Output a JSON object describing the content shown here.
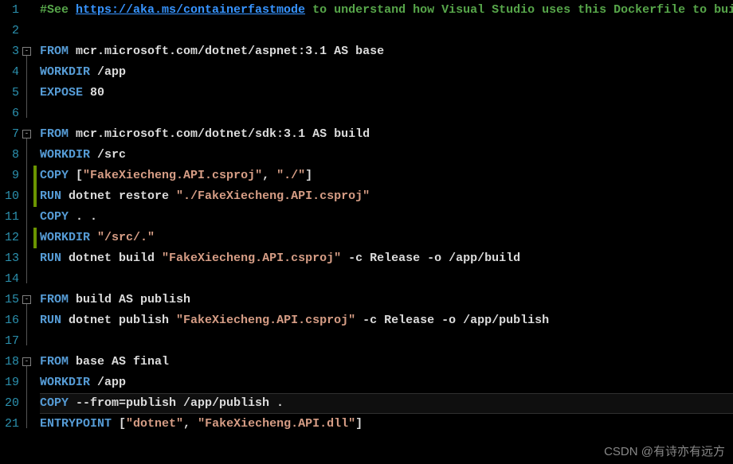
{
  "watermark": "CSDN @有诗亦有远方",
  "currentLine": 20,
  "modified": [
    9,
    10,
    12
  ],
  "foldMarks": [
    3,
    7,
    15,
    18
  ],
  "foldLines": [
    {
      "from": 3,
      "to": 6
    },
    {
      "from": 7,
      "to": 14
    },
    {
      "from": 15,
      "to": 17
    },
    {
      "from": 18,
      "to": 21
    }
  ],
  "lines": [
    {
      "n": 1,
      "tokens": [
        {
          "cls": "c-comment",
          "t": "#See "
        },
        {
          "cls": "c-link",
          "t": "https://aka.ms/containerfastmode"
        },
        {
          "cls": "c-comment",
          "t": " to understand how Visual Studio uses this Dockerfile to build "
        }
      ]
    },
    {
      "n": 2,
      "tokens": []
    },
    {
      "n": 3,
      "tokens": [
        {
          "cls": "c-kw",
          "t": "FROM"
        },
        {
          "cls": "c-white",
          "t": " mcr.microsoft.com/dotnet/aspnet:3.1 AS base"
        }
      ]
    },
    {
      "n": 4,
      "tokens": [
        {
          "cls": "c-kw",
          "t": "WORKDIR"
        },
        {
          "cls": "c-white",
          "t": " /app"
        }
      ]
    },
    {
      "n": 5,
      "tokens": [
        {
          "cls": "c-kw",
          "t": "EXPOSE"
        },
        {
          "cls": "c-white",
          "t": " 80"
        }
      ]
    },
    {
      "n": 6,
      "tokens": []
    },
    {
      "n": 7,
      "tokens": [
        {
          "cls": "c-kw",
          "t": "FROM"
        },
        {
          "cls": "c-white",
          "t": " mcr.microsoft.com/dotnet/sdk:3.1 AS build"
        }
      ]
    },
    {
      "n": 8,
      "tokens": [
        {
          "cls": "c-kw",
          "t": "WORKDIR"
        },
        {
          "cls": "c-white",
          "t": " /src"
        }
      ]
    },
    {
      "n": 9,
      "tokens": [
        {
          "cls": "c-kw",
          "t": "COPY"
        },
        {
          "cls": "c-white",
          "t": " ["
        },
        {
          "cls": "c-str",
          "t": "\"FakeXiecheng.API.csproj\""
        },
        {
          "cls": "c-white",
          "t": ", "
        },
        {
          "cls": "c-str",
          "t": "\"./\""
        },
        {
          "cls": "c-white",
          "t": "]"
        }
      ]
    },
    {
      "n": 10,
      "tokens": [
        {
          "cls": "c-kw",
          "t": "RUN"
        },
        {
          "cls": "c-white",
          "t": " dotnet restore "
        },
        {
          "cls": "c-str",
          "t": "\"./FakeXiecheng.API.csproj\""
        }
      ]
    },
    {
      "n": 11,
      "tokens": [
        {
          "cls": "c-kw",
          "t": "COPY"
        },
        {
          "cls": "c-white",
          "t": " . ."
        }
      ]
    },
    {
      "n": 12,
      "tokens": [
        {
          "cls": "c-kw",
          "t": "WORKDIR"
        },
        {
          "cls": "c-white",
          "t": " "
        },
        {
          "cls": "c-str",
          "t": "\"/src/.\""
        }
      ]
    },
    {
      "n": 13,
      "tokens": [
        {
          "cls": "c-kw",
          "t": "RUN"
        },
        {
          "cls": "c-white",
          "t": " dotnet build "
        },
        {
          "cls": "c-str",
          "t": "\"FakeXiecheng.API.csproj\""
        },
        {
          "cls": "c-white",
          "t": " -c Release -o /app/build"
        }
      ]
    },
    {
      "n": 14,
      "tokens": []
    },
    {
      "n": 15,
      "tokens": [
        {
          "cls": "c-kw",
          "t": "FROM"
        },
        {
          "cls": "c-white",
          "t": " build AS publish"
        }
      ]
    },
    {
      "n": 16,
      "tokens": [
        {
          "cls": "c-kw",
          "t": "RUN"
        },
        {
          "cls": "c-white",
          "t": " dotnet publish "
        },
        {
          "cls": "c-str",
          "t": "\"FakeXiecheng.API.csproj\""
        },
        {
          "cls": "c-white",
          "t": " -c Release -o /app/publish"
        }
      ]
    },
    {
      "n": 17,
      "tokens": []
    },
    {
      "n": 18,
      "tokens": [
        {
          "cls": "c-kw",
          "t": "FROM"
        },
        {
          "cls": "c-white",
          "t": " base AS final"
        }
      ]
    },
    {
      "n": 19,
      "tokens": [
        {
          "cls": "c-kw",
          "t": "WORKDIR"
        },
        {
          "cls": "c-white",
          "t": " /app"
        }
      ]
    },
    {
      "n": 20,
      "tokens": [
        {
          "cls": "c-kw",
          "t": "COPY"
        },
        {
          "cls": "c-white",
          "t": " --from=publish /app/publish ."
        }
      ]
    },
    {
      "n": 21,
      "tokens": [
        {
          "cls": "c-kw",
          "t": "ENTRYPOINT"
        },
        {
          "cls": "c-white",
          "t": " ["
        },
        {
          "cls": "c-str",
          "t": "\"dotnet\""
        },
        {
          "cls": "c-white",
          "t": ", "
        },
        {
          "cls": "c-str",
          "t": "\"FakeXiecheng.API.dll\""
        },
        {
          "cls": "c-white",
          "t": "]"
        }
      ]
    }
  ]
}
